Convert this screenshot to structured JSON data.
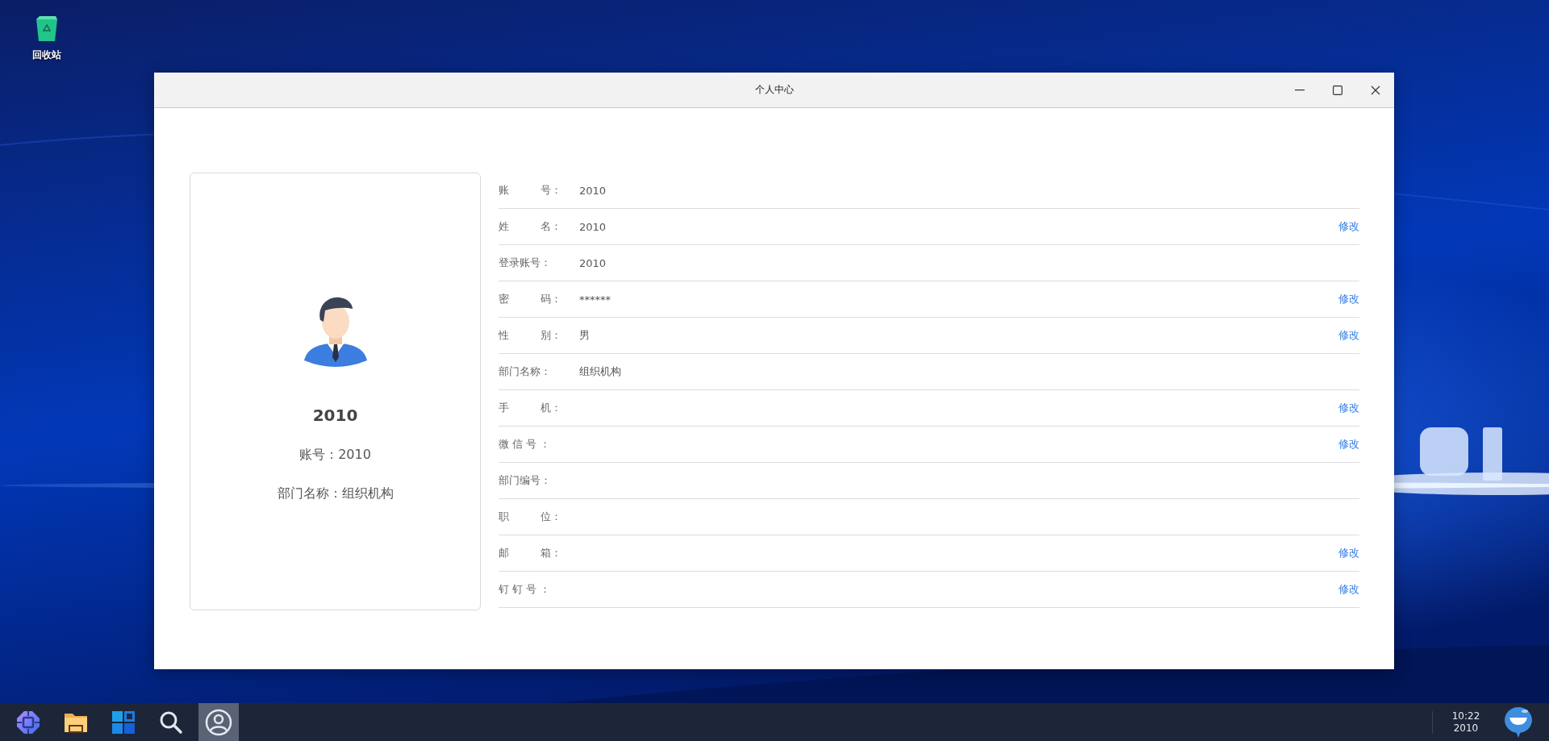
{
  "desktop_icons": [
    {
      "label": "回收站"
    }
  ],
  "window": {
    "title": "个人中心",
    "profile": {
      "name": "2010",
      "account": "账号：2010",
      "department": "部门名称：组织机构"
    },
    "fields": [
      {
        "label": "账　　　号：",
        "value": "2010"
      },
      {
        "label": "姓　　　名：",
        "value": "2010",
        "action": "修改"
      },
      {
        "label": "登录账号：",
        "value": "2010"
      },
      {
        "label": "密　　　码：",
        "value": "******",
        "action": "修改"
      },
      {
        "label": "性　　　别：",
        "value": "男",
        "action": "修改"
      },
      {
        "label": "部门名称：",
        "value": "组织机构"
      },
      {
        "label": "手　　　机：",
        "action": "修改"
      },
      {
        "label": "微 信 号 ：",
        "action": "修改"
      },
      {
        "label": "部门编号："
      },
      {
        "label": "职　　　位："
      },
      {
        "label": "邮　　　箱：",
        "action": "修改"
      },
      {
        "label": "钉 钉 号 ：",
        "action": "修改"
      }
    ]
  },
  "taskbar": {
    "apps": [
      {
        "kind": "launcher",
        "selected": false
      },
      {
        "kind": "folder",
        "selected": false
      },
      {
        "kind": "windows",
        "selected": false
      },
      {
        "kind": "search",
        "selected": false
      },
      {
        "kind": "user",
        "selected": true
      }
    ],
    "clock": {
      "time": "10:22",
      "date": "2010"
    }
  }
}
